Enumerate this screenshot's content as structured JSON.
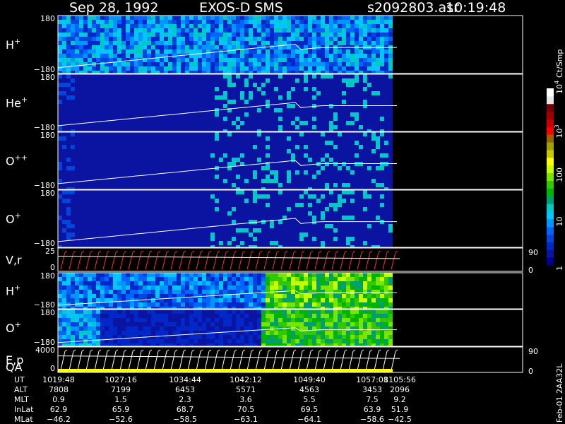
{
  "header": {
    "date": "Sep 28, 1992",
    "instrument": "EXOS-D SMS",
    "file": "s2092803.asr",
    "time": "10:19:48"
  },
  "colorbar": {
    "label": "Ct/Smp",
    "tick_labels": [
      "1",
      "10",
      "100",
      "10",
      "10"
    ],
    "tick_exponents": [
      "",
      "",
      "",
      "3",
      "4"
    ],
    "tick_values": [
      1,
      10,
      100,
      1000,
      10000
    ],
    "colors": [
      "#00008c",
      "#0a14a0",
      "#0028c8",
      "#0046dc",
      "#0064ff",
      "#0096ff",
      "#00c8ff",
      "#00c8c8",
      "#00a06e",
      "#00b400",
      "#32c800",
      "#78e600",
      "#c8ff00",
      "#ffff00",
      "#c8c800",
      "#a0a000",
      "#966400",
      "#ff0000",
      "#c80000",
      "#a00000",
      "#780000",
      "#e6e6e6",
      "#ffffff"
    ]
  },
  "panels": [
    {
      "id": "h-plus-1",
      "species": "H",
      "charge": "+",
      "ymax": "180",
      "ymin": "−180",
      "right": "",
      "type": "spectrogram"
    },
    {
      "id": "he-plus",
      "species": "He",
      "charge": "+",
      "ymax": "180",
      "ymin": "−180",
      "right": "",
      "type": "spectrogram"
    },
    {
      "id": "o-plus-plus",
      "species": "O",
      "charge": "++",
      "ymax": "180",
      "ymin": "−180",
      "right": "",
      "type": "spectrogram"
    },
    {
      "id": "o-plus-1",
      "species": "O",
      "charge": "+",
      "ymax": "180",
      "ymin": "−180",
      "right": "",
      "type": "spectrogram"
    },
    {
      "id": "v-r",
      "species": "V,r",
      "charge": "",
      "ymax": "25",
      "ymin": "0",
      "right_top": "90",
      "right_bottom": "0",
      "type": "line"
    },
    {
      "id": "h-plus-2",
      "species": "H",
      "charge": "+",
      "ymax": "180",
      "ymin": "−180",
      "right": "",
      "type": "spectrogram"
    },
    {
      "id": "o-plus-2",
      "species": "O",
      "charge": "+",
      "ymax": "180",
      "ymin": "−180",
      "right": "",
      "type": "spectrogram"
    },
    {
      "id": "e-p-qa",
      "species": "E,p",
      "species2": "QA",
      "charge": "",
      "ymax": "4000",
      "ymin": "0",
      "right_top": "90",
      "right_bottom": "0",
      "type": "line"
    }
  ],
  "footer": {
    "rows": [
      {
        "label": "UT",
        "values": [
          "1019:48",
          "1027:16",
          "1034:44",
          "1042:12",
          "1049:40",
          "1057:08",
          "1105:56"
        ]
      },
      {
        "label": "ALT",
        "values": [
          "7808",
          "7199",
          "6453",
          "5571",
          "4563",
          "3453",
          "2096"
        ]
      },
      {
        "label": "MLT",
        "values": [
          "0.9",
          "1.5",
          "2.3",
          "3.6",
          "5.5",
          "7.5",
          "9.2"
        ]
      },
      {
        "label": "InLat",
        "values": [
          "62.9",
          "65.9",
          "68.7",
          "70.5",
          "69.5",
          "63.9",
          "51.9"
        ]
      },
      {
        "label": "MLat",
        "values": [
          "−46.2",
          "−52.6",
          "−58.5",
          "−63.1",
          "−64.1",
          "−58.6",
          "−42.5"
        ]
      }
    ],
    "side_note": "Feb-01 2AA32L"
  },
  "chart_data": {
    "type": "heatmap",
    "title": "Sep 28, 1992   EXOS-D SMS",
    "x_ticks_ut": [
      "1019:48",
      "1027:16",
      "1034:44",
      "1042:12",
      "1049:40",
      "1057:08",
      "1105:56"
    ],
    "ylim_pitch": [
      -180,
      180
    ],
    "colorbar_range_ct_per_sample": [
      1,
      10000
    ],
    "colorbar_log": true
  }
}
